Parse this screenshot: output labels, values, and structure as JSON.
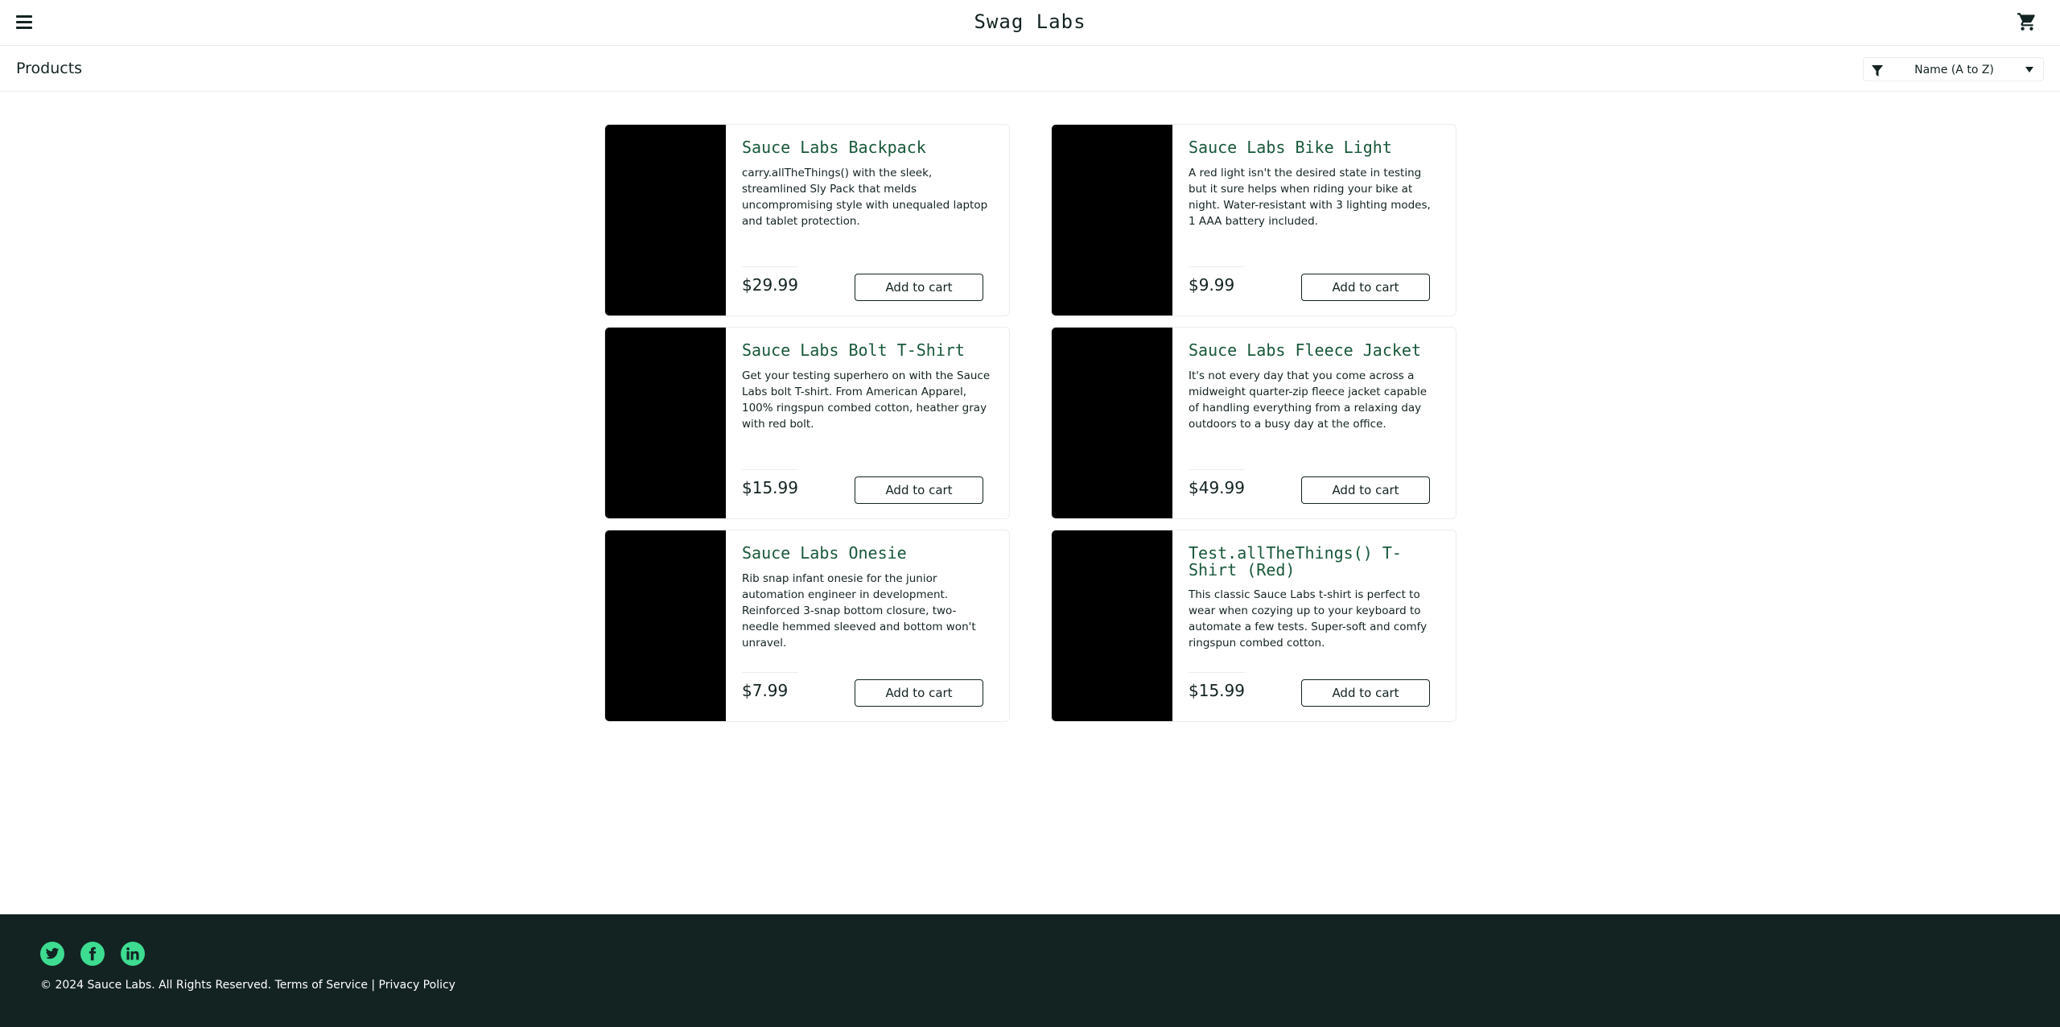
{
  "header": {
    "title": "Swag Labs",
    "menu_icon": "hamburger-menu-icon",
    "cart_icon": "shopping-cart-icon"
  },
  "subheader": {
    "title": "Products",
    "sort": {
      "selected": "Name (A to Z)",
      "icon": "filter-funnel-icon"
    }
  },
  "products": [
    {
      "name": "Sauce Labs Backpack",
      "description": "carry.allTheThings() with the sleek, streamlined Sly Pack that melds uncompromising style with unequaled laptop and tablet protection.",
      "price": "$29.99",
      "button": "Add to cart"
    },
    {
      "name": "Sauce Labs Bike Light",
      "description": "A red light isn't the desired state in testing but it sure helps when riding your bike at night. Water-resistant with 3 lighting modes, 1 AAA battery included.",
      "price": "$9.99",
      "button": "Add to cart"
    },
    {
      "name": "Sauce Labs Bolt T-Shirt",
      "description": "Get your testing superhero on with the Sauce Labs bolt T-shirt. From American Apparel, 100% ringspun combed cotton, heather gray with red bolt.",
      "price": "$15.99",
      "button": "Add to cart"
    },
    {
      "name": "Sauce Labs Fleece Jacket",
      "description": "It's not every day that you come across a midweight quarter-zip fleece jacket capable of handling everything from a relaxing day outdoors to a busy day at the office.",
      "price": "$49.99",
      "button": "Add to cart"
    },
    {
      "name": "Sauce Labs Onesie",
      "description": "Rib snap infant onesie for the junior automation engineer in development. Reinforced 3-snap bottom closure, two-needle hemmed sleeved and bottom won't unravel.",
      "price": "$7.99",
      "button": "Add to cart"
    },
    {
      "name": "Test.allTheThings() T-Shirt (Red)",
      "description": "This classic Sauce Labs t-shirt is perfect to wear when cozying up to your keyboard to automate a few tests. Super-soft and comfy ringspun combed cotton.",
      "price": "$15.99",
      "button": "Add to cart"
    }
  ],
  "footer": {
    "social": [
      "twitter-icon",
      "facebook-icon",
      "linkedin-icon"
    ],
    "copyright": "© 2024 Sauce Labs. All Rights Reserved. Terms of Service | Privacy Policy"
  },
  "colors": {
    "dark": "#132322",
    "accent_green": "#3ddc91",
    "title_green": "#18583a",
    "border": "#ededed"
  }
}
